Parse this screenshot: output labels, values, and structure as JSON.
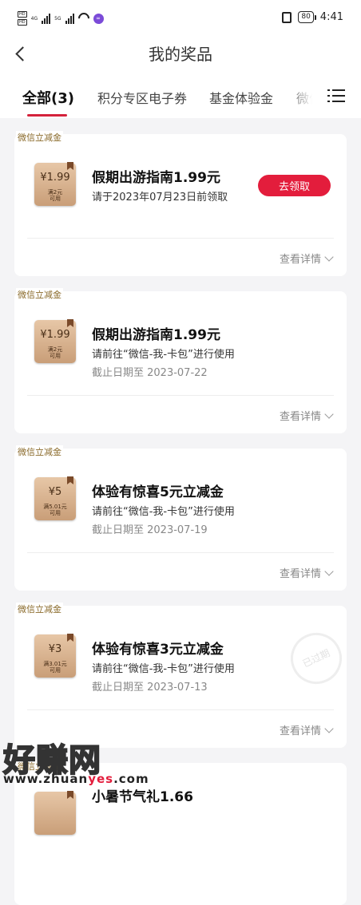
{
  "status_bar": {
    "sim1": "HD",
    "sim2": "HD",
    "net1": "4G",
    "net2": "5G",
    "battery": "80",
    "time": "4:41"
  },
  "header": {
    "title": "我的奖品"
  },
  "tabs": [
    {
      "label": "全部(3)",
      "active": true
    },
    {
      "label": "积分专区电子券",
      "active": false
    },
    {
      "label": "基金体验金",
      "active": false
    },
    {
      "label": "微信",
      "active": false
    }
  ],
  "cards": [
    {
      "tag": "微信立减金",
      "voucher_amount": "¥1.99",
      "voucher_cond": "满2元\n可用",
      "name": "假期出游指南1.99元",
      "line2": "请于2023年07月23日前领取",
      "line3": "",
      "button": "去领取",
      "details": "查看详情"
    },
    {
      "tag": "微信立减金",
      "voucher_amount": "¥1.99",
      "voucher_cond": "满2元\n可用",
      "name": "假期出游指南1.99元",
      "line2": "请前往“微信-我-卡包”进行使用",
      "line3": "截止日期至 2023-07-22",
      "details": "查看详情"
    },
    {
      "tag": "微信立减金",
      "voucher_amount": "¥5",
      "voucher_cond": "满5.01元\n可用",
      "name": "体验有惊喜5元立减金",
      "line2": "请前往“微信-我-卡包”进行使用",
      "line3": "截止日期至 2023-07-19",
      "details": "查看详情"
    },
    {
      "tag": "微信立减金",
      "voucher_amount": "¥3",
      "voucher_cond": "满3.01元\n可用",
      "name": "体验有惊喜3元立减金",
      "line2": "请前往“微信-我-卡包”进行使用",
      "line3": "截止日期至 2023-07-13",
      "details": "查看详情",
      "stamp": "已过期"
    },
    {
      "tag": "微信立减金",
      "name": "小暑节气礼1.66"
    }
  ],
  "watermark": {
    "big": "好赚网",
    "url_prefix": "www.zhuan",
    "url_highlight": "yes",
    "url_suffix": ".com"
  }
}
